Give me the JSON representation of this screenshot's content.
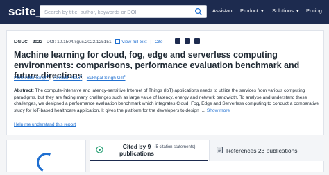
{
  "header": {
    "logo": "scite_",
    "search_placeholder": "Search by title, author, keywords or DOI",
    "nav": [
      {
        "label": "Assistant",
        "has_menu": false
      },
      {
        "label": "Product",
        "has_menu": true
      },
      {
        "label": "Solutions",
        "has_menu": true
      },
      {
        "label": "Pricing",
        "has_menu": false
      }
    ]
  },
  "paper": {
    "journal": "IJGUC",
    "year": "2022",
    "doi": "DOI: 10.1504/ijguc.2022.125151",
    "view_full_text": "View full text",
    "cite": "Cite",
    "title": "Machine learning for cloud, fog, edge and serverless computing environments: comparisons, performance evaluation benchmark and future directions",
    "authors": [
      {
        "name": "Parminder Singh",
        "sup": "1"
      },
      {
        "name": "Avinash Kaur",
        "sup": "2"
      },
      {
        "name": "Sukhpal Singh Gill",
        "sup": "3"
      }
    ],
    "abstract_label": "Abstract:",
    "abstract_text": " The compute-intensive and latency-sensitive Internet of Things (IoT) applications needs to utilize the services from various computing paradigms, but they are facing many challenges such as large value of latency, energy and network bandwidth. To analyse and understand these challenges, we designed a performance evaluation benchmark which integrates Cloud, Fog, Edge and Serverless computing to conduct a comparative study for IoT-based healthcare application. It gives the platform for the developers to design I...",
    "show_more": "Show more",
    "help_link": "Help me understand this report"
  },
  "tabs": {
    "cited": "Cited by 9 publications",
    "cited_sub": "(5 citation statements)",
    "references": "References 23 publications"
  },
  "colors": {
    "header_bg": "#1d2b4f",
    "link": "#1f6fd0",
    "share_icons": "#1d2b4f"
  },
  "icons": {
    "search": "search-icon",
    "share": [
      "twitter-icon",
      "facebook-icon",
      "linkedin-icon"
    ],
    "cited": "quote-bubble-icon",
    "references": "document-icon"
  }
}
